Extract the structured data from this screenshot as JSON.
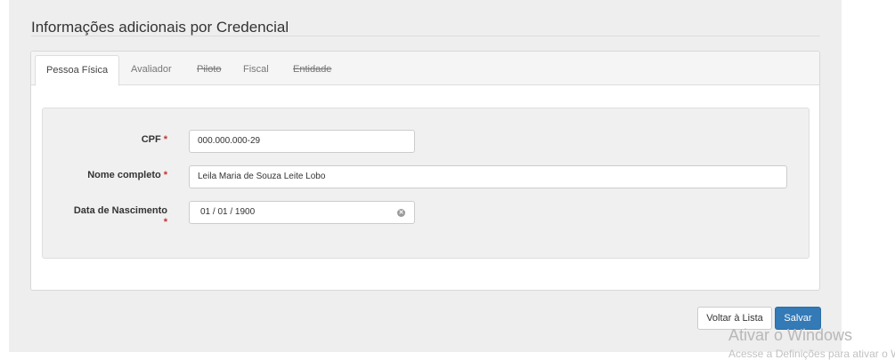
{
  "page": {
    "title": "Informações adicionais por Credencial"
  },
  "tabs": [
    {
      "label": "Pessoa Física",
      "active": true,
      "disabled": false
    },
    {
      "label": "Avaliador",
      "active": false,
      "disabled": false
    },
    {
      "label": "Piloto",
      "active": false,
      "disabled": true
    },
    {
      "label": "Fiscal",
      "active": false,
      "disabled": false
    },
    {
      "label": "Entidade",
      "active": false,
      "disabled": true
    }
  ],
  "form": {
    "cpf": {
      "label": "CPF",
      "required_mark": "*",
      "value": "000.000.000-29"
    },
    "nome": {
      "label": "Nome completo",
      "required_mark": "*",
      "value": "Leila Maria de Souza Leite Lobo"
    },
    "nascimento": {
      "label": "Data de Nascimento",
      "required_mark": "*",
      "value": "01 / 01 / 1900"
    }
  },
  "actions": {
    "back_label": "Voltar à Lista",
    "save_label": "Salvar"
  },
  "watermark": {
    "line1": "Ativar o Windows",
    "line2": "Acesse a Definições para ativar o Windows."
  },
  "colors": {
    "primary": "#337ab7",
    "required": "#c9302c",
    "panel_bg": "#eeeeee"
  }
}
